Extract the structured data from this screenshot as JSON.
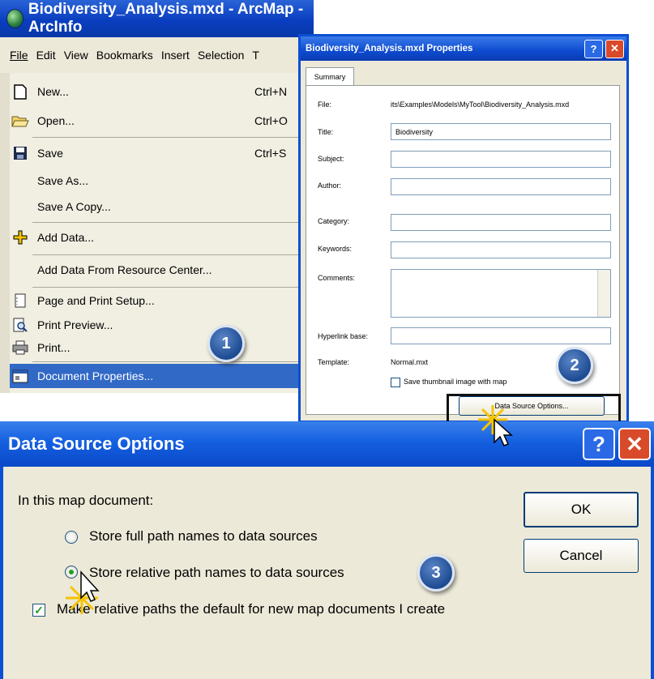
{
  "arcmap": {
    "title": "Biodiversity_Analysis.mxd - ArcMap - ArcInfo",
    "menubar": [
      "File",
      "Edit",
      "View",
      "Bookmarks",
      "Insert",
      "Selection",
      "T"
    ],
    "menu_items": [
      {
        "label": "New...",
        "shortcut": "Ctrl+N",
        "icon": "new-file-icon"
      },
      {
        "label": "Open...",
        "shortcut": "Ctrl+O",
        "icon": "open-folder-icon"
      },
      {
        "label": "Save",
        "shortcut": "Ctrl+S",
        "icon": "save-disk-icon"
      },
      {
        "label": "Save As...",
        "shortcut": "",
        "icon": ""
      },
      {
        "label": "Save A Copy...",
        "shortcut": "",
        "icon": ""
      },
      {
        "label": "Add Data...",
        "shortcut": "",
        "icon": "add-data-icon"
      },
      {
        "label": "Add Data From Resource Center...",
        "shortcut": "",
        "icon": ""
      },
      {
        "label": "Page and Print Setup...",
        "shortcut": "",
        "icon": "page-setup-icon"
      },
      {
        "label": "Print Preview...",
        "shortcut": "",
        "icon": "print-preview-icon"
      },
      {
        "label": "Print...",
        "shortcut": "",
        "icon": "printer-icon"
      },
      {
        "label": "Document Properties...",
        "shortcut": "",
        "icon": "document-properties-icon"
      }
    ]
  },
  "properties_dialog": {
    "title": "Biodiversity_Analysis.mxd Properties",
    "tab": "Summary",
    "file_label": "File:",
    "file_value": "its\\Examples\\Models\\MyTool\\Biodiversity_Analysis.mxd",
    "title_label": "Title:",
    "title_value": "Biodiversity",
    "subject_label": "Subject:",
    "author_label": "Author:",
    "category_label": "Category:",
    "keywords_label": "Keywords:",
    "comments_label": "Comments:",
    "hyperlink_label": "Hyperlink base:",
    "template_label": "Template:",
    "template_value": "Normal.mxt",
    "thumbnail_label": "Save thumbnail image with map",
    "data_source_button": "Data Source Options..."
  },
  "data_source_dialog": {
    "title": "Data Source Options",
    "intro": "In this map document:",
    "option_full": "Store full path names to data sources",
    "option_relative": "Store relative path names to data sources",
    "selected_option": "relative",
    "default_check_label": "Make relative paths the default for new map documents I create",
    "default_checked": true,
    "ok_label": "OK",
    "cancel_label": "Cancel"
  },
  "steps": [
    "1",
    "2",
    "3"
  ],
  "colors": {
    "title_blue": "#0a48c8",
    "selection_blue": "#3169c6",
    "step_blue": "#1d4b91"
  }
}
